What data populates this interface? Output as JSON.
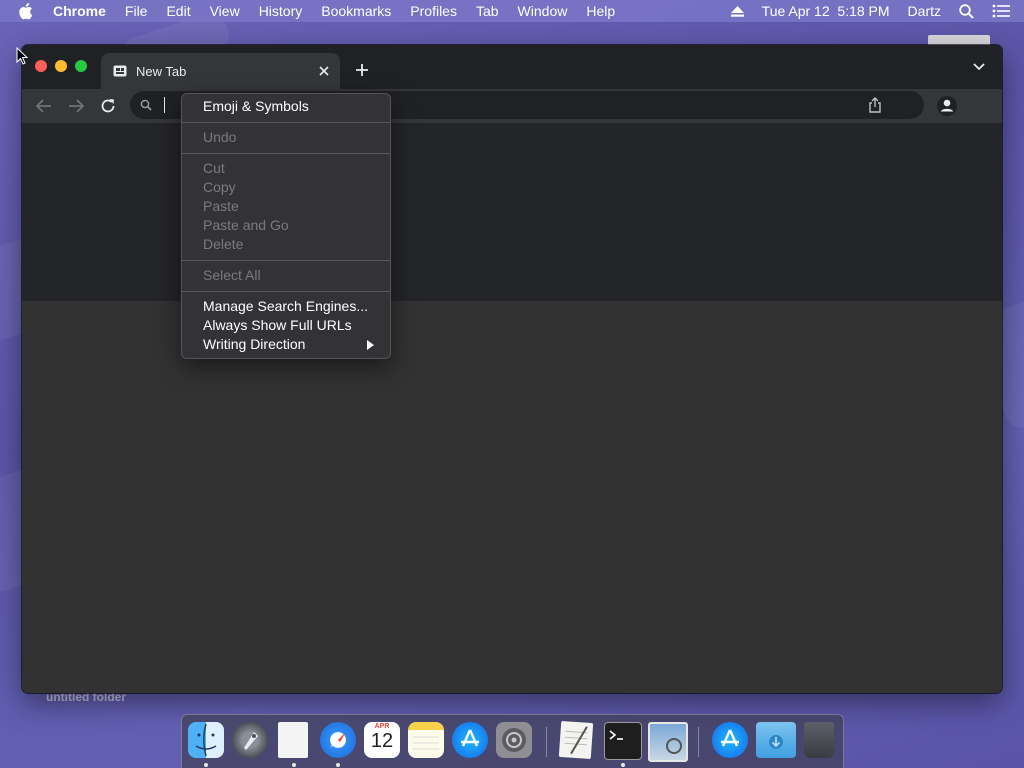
{
  "menubar": {
    "apple_icon": "apple-logo-icon",
    "items": [
      {
        "label": "Chrome",
        "is_app": true
      },
      {
        "label": "File"
      },
      {
        "label": "Edit"
      },
      {
        "label": "View"
      },
      {
        "label": "History"
      },
      {
        "label": "Bookmarks"
      },
      {
        "label": "Profiles"
      },
      {
        "label": "Tab"
      },
      {
        "label": "Window"
      },
      {
        "label": "Help"
      }
    ],
    "status": {
      "eject_icon": "eject-icon",
      "datetime": "Tue Apr 12  5:18 PM",
      "user": "Dartz",
      "spotlight_icon": "spotlight-search-icon",
      "control_icon": "notification-list-icon"
    }
  },
  "desktop": {
    "folder_label": "untitled folder"
  },
  "browser": {
    "tab": {
      "title": "New Tab"
    },
    "omnibox": {
      "value": "",
      "placeholder": ""
    }
  },
  "context_menu": {
    "items": [
      {
        "label": "Emoji & Symbols",
        "enabled": true
      },
      {
        "label": "Undo",
        "enabled": false
      },
      {
        "label": "Cut",
        "enabled": false
      },
      {
        "label": "Copy",
        "enabled": false
      },
      {
        "label": "Paste",
        "enabled": false
      },
      {
        "label": "Paste and Go",
        "enabled": false
      },
      {
        "label": "Delete",
        "enabled": false
      },
      {
        "label": "Select All",
        "enabled": false
      },
      {
        "label": "Manage Search Engines...",
        "enabled": true
      },
      {
        "label": "Always Show Full URLs",
        "enabled": true
      },
      {
        "label": "Writing Direction",
        "enabled": true,
        "submenu": true
      }
    ]
  },
  "dock": {
    "apps": [
      "finder",
      "launchpad",
      "textedit-document",
      "safari",
      "calendar",
      "notes",
      "app-store",
      "system-preferences",
      "textedit",
      "terminal",
      "preview",
      "app-store-downloads",
      "downloads-folder",
      "trash"
    ],
    "calendar": {
      "month": "APR",
      "day": "12"
    },
    "colors": {
      "finder": "#3aa0f0",
      "safari": "#2f8cf4",
      "app_store": "#1f8ff5",
      "terminal": "#1e1e1e"
    }
  }
}
